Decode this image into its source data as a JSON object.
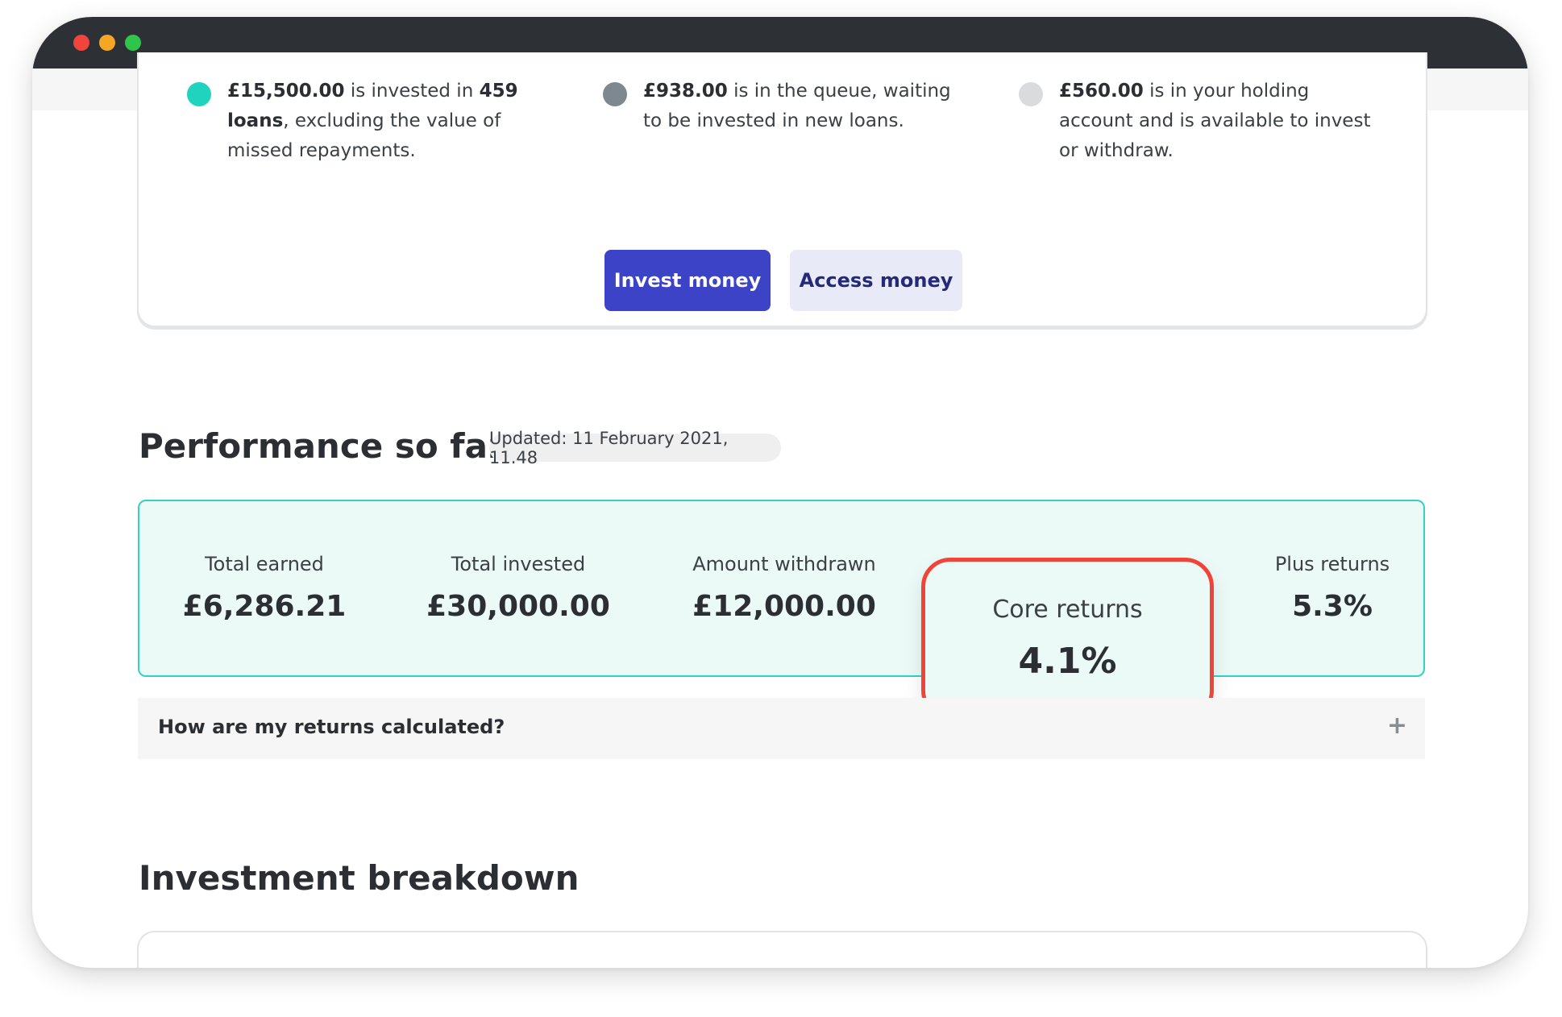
{
  "holdings": [
    {
      "segments": [
        {
          "t": "£15,500.00",
          "b": true
        },
        {
          "t": " is invested in ",
          "b": false
        },
        {
          "t": "459 loans",
          "b": true
        },
        {
          "t": ", excluding the value of missed repayments.",
          "b": false
        }
      ],
      "dot_color": "#1fd3bf"
    },
    {
      "segments": [
        {
          "t": "£938.00",
          "b": true
        },
        {
          "t": " is in the queue, waiting to be invested in new loans.",
          "b": false
        }
      ],
      "dot_color": "#7e8891"
    },
    {
      "segments": [
        {
          "t": "£560.00",
          "b": true
        },
        {
          "t": " is in your holding account and is available to invest or withdraw.",
          "b": false
        }
      ],
      "dot_color": "#d9dbdd"
    }
  ],
  "buttons": {
    "invest": "Invest money",
    "access": "Access money"
  },
  "performance": {
    "title": "Performance so far",
    "updated": "Updated: 11 February 2021, 11.48",
    "metrics": [
      {
        "label": "Total earned",
        "value": "£6,286.21"
      },
      {
        "label": "Total invested",
        "value": "£30,000.00"
      },
      {
        "label": "Amount withdrawn",
        "value": "£12,000.00"
      },
      {
        "label": "Core returns",
        "value": "4.1%"
      },
      {
        "label": "Plus returns",
        "value": "5.3%"
      }
    ],
    "highlight_color": "#f04438"
  },
  "accordion": {
    "question": "How are my returns calculated?",
    "icon": "plus-icon"
  },
  "breakdown": {
    "title": "Investment breakdown"
  }
}
